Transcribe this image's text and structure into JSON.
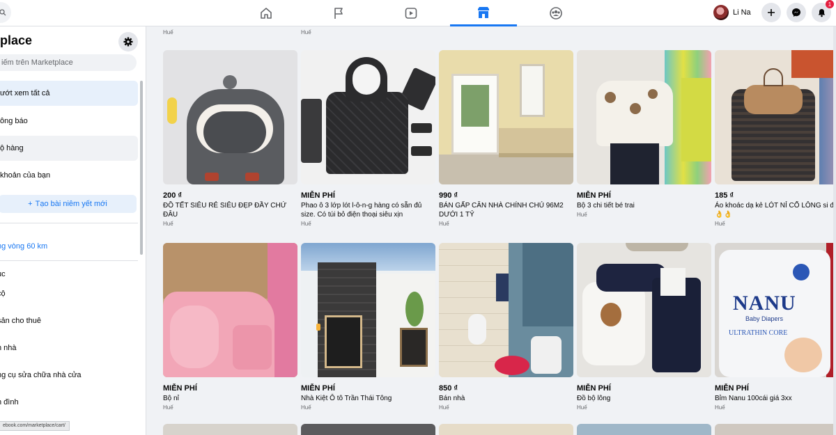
{
  "topbar": {
    "profile_name": "Li Na",
    "notification_count": "1",
    "nav_tabs": [
      "home-icon",
      "flag-icon",
      "video-icon",
      "marketplace-icon",
      "groups-icon"
    ],
    "active_tab": "marketplace-icon"
  },
  "sidebar": {
    "title": "etplace",
    "search_placeholder": "iếm trên Marketplace",
    "items": [
      {
        "label": "ướt xem tất cả"
      },
      {
        "label": "ông báo"
      },
      {
        "label": "ộ hàng"
      },
      {
        "label": "khoản của bạn"
      }
    ],
    "create_label": "Tạo bài niêm yết mới",
    "location_label": "ng vòng 60 km",
    "categories_heading": "ục",
    "categories": [
      "cộ",
      "sản cho thuê",
      "n nhà",
      "ng cụ sửa chữa nhà cửa",
      "n đình"
    ],
    "status_url": "ebook.com/marketplace/cart/"
  },
  "top_locations": [
    "Huế",
    "Huế"
  ],
  "listings": [
    {
      "price": "200 ₫",
      "title": "ĐỒ TẾT SIÊU RẺ SIÊU ĐẸP ĐẦY CHỨ ĐÂU",
      "location": "Huế"
    },
    {
      "price": "MIỄN PHÍ",
      "title": "Phao ô 3 lớp lót l-ô-n-g hàng có sẵn đủ size. Có túi bỏ điện thoại siêu xịn",
      "location": "Huế"
    },
    {
      "price": "990 ₫",
      "title": "BÁN GẤP CĂN NHÀ CHÍNH CHỦ 96M2 DƯỚI 1 TỶ",
      "location": "Huế"
    },
    {
      "price": "MIỄN PHÍ",
      "title": "Bộ 3 chi tiết bé trai",
      "location": "Huế"
    },
    {
      "price": "185 ₫",
      "title": "Áo khoác dạ kẻ LÓT NỈ CỔ LÔNG si đẹp👌👌",
      "location": "Huế"
    },
    {
      "price": "MIỄN PHÍ",
      "title": "Bộ nỉ",
      "location": "Huế"
    },
    {
      "price": "MIỄN PHÍ",
      "title": "Nhà Kiệt Ô tô Trần Thái Tông",
      "location": "Huế"
    },
    {
      "price": "850 ₫",
      "title": "Bán nhà",
      "location": "Huế"
    },
    {
      "price": "MIỄN PHÍ",
      "title": "Đồ bộ lông",
      "location": "Huế"
    },
    {
      "price": "MIỄN PHÍ",
      "title": "Bỉm Nanu 100cái giá 3xx",
      "location": "Huế"
    }
  ],
  "diaper_brand": {
    "name": "NANU",
    "sub": "Baby Diapers",
    "line": "ULTRATHIN CORE"
  },
  "colors": {
    "accent": "#1877f2",
    "badge": "#e41e3f",
    "page_bg": "#f0f2f5"
  }
}
